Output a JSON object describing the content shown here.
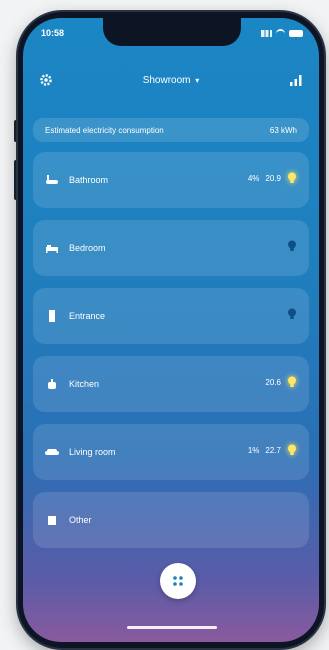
{
  "status": {
    "time": "10:58"
  },
  "header": {
    "title": "Showroom",
    "chevron": "▾"
  },
  "consumption": {
    "label": "Estimated electricity consumption",
    "value": "63 kWh"
  },
  "rooms": [
    {
      "name": "Bathroom",
      "icon": "bath-icon",
      "humidity": "4%",
      "temp": "20.9",
      "light_on": true
    },
    {
      "name": "Bedroom",
      "icon": "bed-icon",
      "humidity": "",
      "temp": "",
      "light_on": false
    },
    {
      "name": "Entrance",
      "icon": "door-icon",
      "humidity": "",
      "temp": "",
      "light_on": false
    },
    {
      "name": "Kitchen",
      "icon": "pot-icon",
      "humidity": "",
      "temp": "20.6",
      "light_on": true
    },
    {
      "name": "Living room",
      "icon": "sofa-icon",
      "humidity": "1%",
      "temp": "22.7",
      "light_on": true
    },
    {
      "name": "Other",
      "icon": "box-icon",
      "humidity": "",
      "temp": "",
      "light_on": null
    }
  ],
  "colors": {
    "bulb_on": "#ffe766",
    "bulb_off": "#0e4f86",
    "screen_top": "#1b86c4",
    "screen_bottom": "#8a5a9e"
  }
}
